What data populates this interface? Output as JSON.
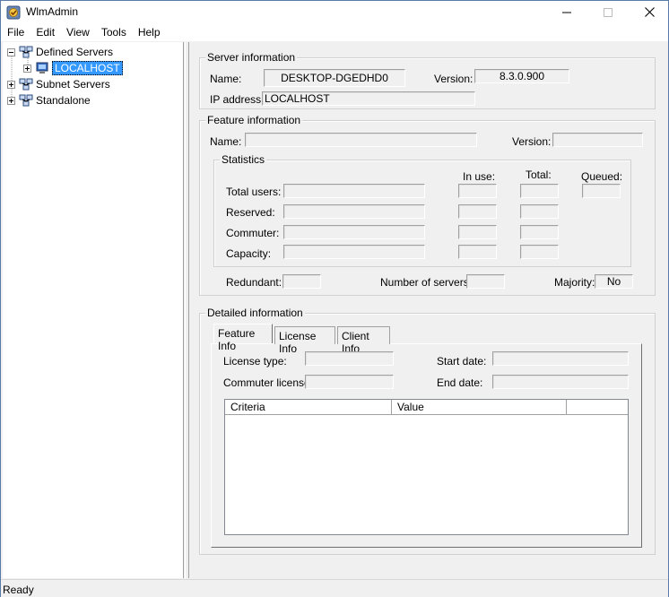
{
  "window": {
    "title": "WlmAdmin"
  },
  "menu": [
    "File",
    "Edit",
    "View",
    "Tools",
    "Help"
  ],
  "tree": {
    "defined_servers": "Defined Servers",
    "localhost": "LOCALHOST",
    "subnet_servers": "Subnet Servers",
    "standalone": "Standalone"
  },
  "server_info": {
    "legend": "Server information",
    "name_label": "Name:",
    "name_value": "DESKTOP-DGEDHD0",
    "version_label": "Version:",
    "version_value": "8.3.0.900",
    "ip_label": "IP address:",
    "ip_value": "LOCALHOST"
  },
  "feature_info": {
    "legend": "Feature information",
    "name_label": "Name:",
    "name_value": "",
    "version_label": "Version:",
    "version_value": "",
    "statistics": {
      "legend": "Statistics",
      "col_in_use": "In use:",
      "col_total": "Total:",
      "col_queued": "Queued:",
      "rows": [
        "Total users:",
        "Reserved:",
        "Commuter:",
        "Capacity:"
      ]
    },
    "redundant_label": "Redundant:",
    "redundant_value": "",
    "num_servers_label": "Number of servers:",
    "num_servers_value": "",
    "majority_label": "Majority:",
    "majority_value": "No"
  },
  "detailed_info": {
    "legend": "Detailed information",
    "tabs": [
      "Feature Info",
      "License Info",
      "Client Info"
    ],
    "license_type_label": "License type:",
    "license_type_value": "",
    "start_date_label": "Start date:",
    "start_date_value": "",
    "commuter_license_label": "Commuter license:",
    "commuter_license_value": "",
    "end_date_label": "End date:",
    "end_date_value": "",
    "columns": [
      "Criteria",
      "Value",
      ""
    ]
  },
  "status": {
    "text": "Ready"
  }
}
